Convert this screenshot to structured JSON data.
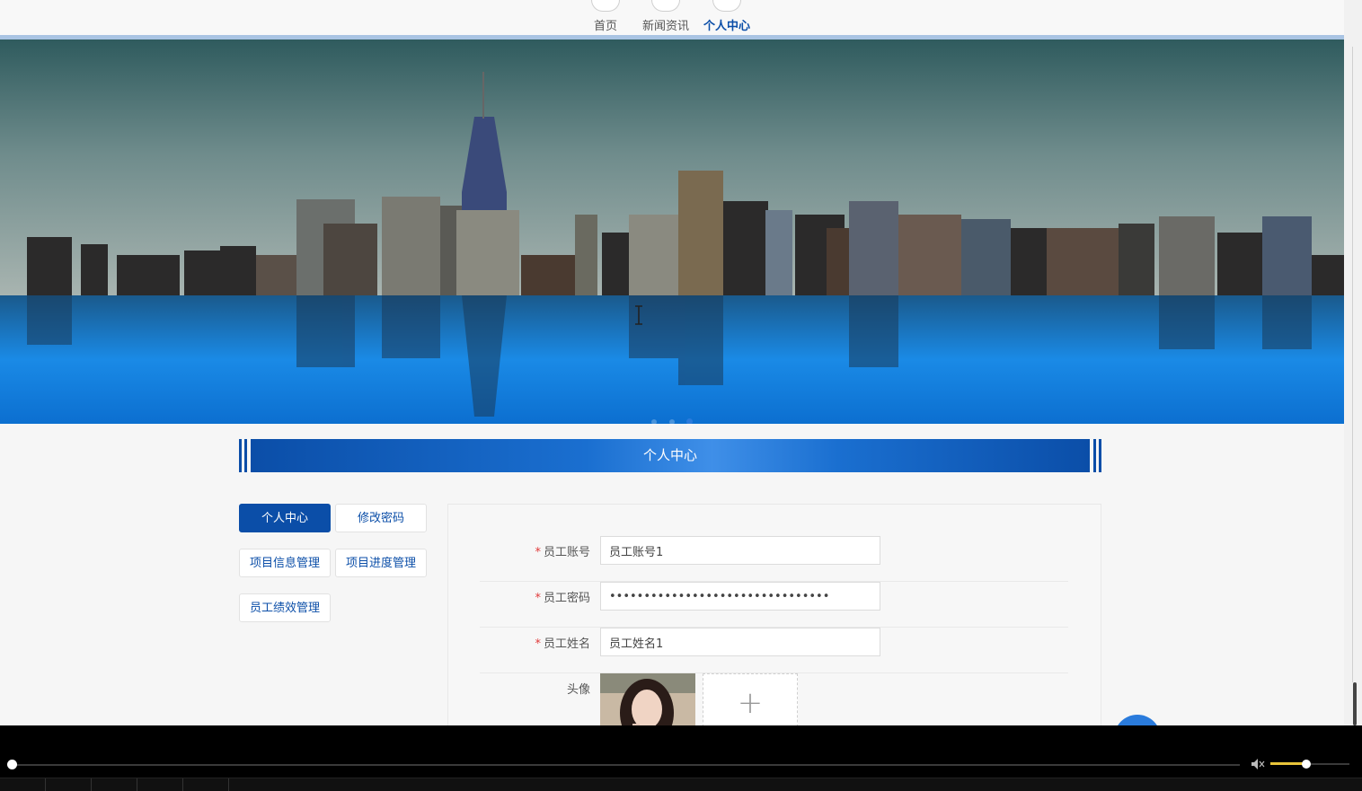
{
  "nav": {
    "items": [
      {
        "label": "首页",
        "active": false
      },
      {
        "label": "新闻资讯",
        "active": false
      },
      {
        "label": "个人中心",
        "active": true
      }
    ]
  },
  "banner": {
    "slide_count": 3,
    "active_slide": 3
  },
  "section": {
    "title": "个人中心"
  },
  "menu": {
    "items": [
      {
        "label": "个人中心",
        "active": true
      },
      {
        "label": "修改密码",
        "active": false
      },
      {
        "label": "项目信息管理",
        "active": false
      },
      {
        "label": "项目进度管理",
        "active": false
      },
      {
        "label": "员工绩效管理",
        "active": false
      }
    ]
  },
  "form": {
    "account": {
      "label": "员工账号",
      "required": "*",
      "value": "员工账号1"
    },
    "password": {
      "label": "员工密码",
      "required": "*",
      "value": "••••••••••••••••••••••••••••••••"
    },
    "name": {
      "label": "员工姓名",
      "required": "*",
      "value": "员工姓名1"
    },
    "avatar": {
      "label": "头像",
      "upload_symbol": "+"
    }
  },
  "colors": {
    "primary": "#0b4ea8",
    "accent": "#2a7bdc",
    "volume": "#e8c43a"
  },
  "player": {
    "volume_fraction": 0.45,
    "progress_fraction": 0.0
  }
}
